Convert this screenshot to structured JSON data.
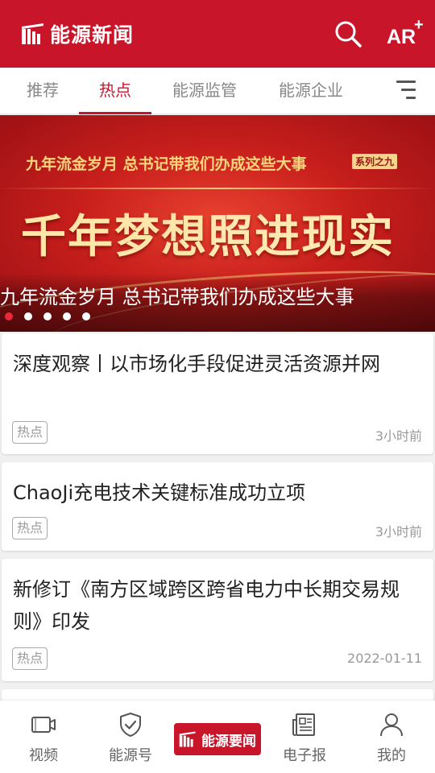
{
  "header": {
    "app_title": "能源新闻",
    "ar_label": "AR",
    "ar_plus": "+",
    "bg_color": "#c8152a"
  },
  "tabs": [
    {
      "label": "推荐",
      "active": false
    },
    {
      "label": "热点",
      "active": true
    },
    {
      "label": "能源监管",
      "active": false
    },
    {
      "label": "能源企业",
      "active": false
    }
  ],
  "banner": {
    "subtitle": "九年流金岁月 总书记带我们办成这些大事",
    "series_badge": "系列之九",
    "headline_part1": "千年梦想",
    "headline_part2": "照进现实",
    "caption": "九年流金岁月 总书记带我们办成这些大事",
    "dots_total": 5,
    "dots_active_index": 0
  },
  "news": [
    {
      "title": "深度观察丨以市场化手段促进灵活资源并网",
      "tag": "热点",
      "time": "3小时前"
    },
    {
      "title": "ChaoJi充电技术关键标准成功立项",
      "tag": "热点",
      "time": "3小时前"
    },
    {
      "title": "新修订《南方区域跨区跨省电力中长期交易规则》印发",
      "tag": "热点",
      "time": "2022-01-11"
    }
  ],
  "bottom_nav": {
    "items": [
      {
        "label": "视频",
        "icon": "video-icon"
      },
      {
        "label": "能源号",
        "icon": "shield-check-icon"
      },
      {
        "label": "电子报",
        "icon": "newspaper-icon"
      },
      {
        "label": "我的",
        "icon": "user-icon"
      }
    ],
    "center_label": "能源要闻"
  }
}
